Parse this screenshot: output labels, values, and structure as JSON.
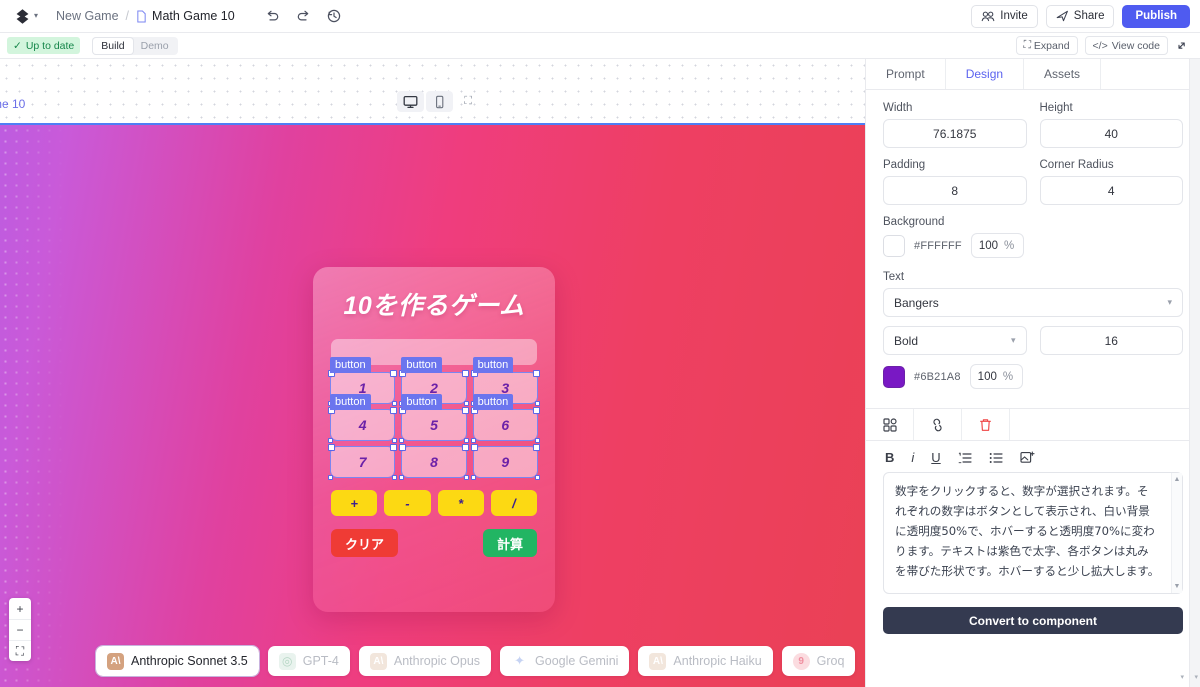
{
  "topbar": {
    "logo_icon": "editor-logo-icon",
    "logo_caret": "chevron-down-icon",
    "breadcrumb_project": "New Game",
    "breadcrumb_sep": "/",
    "breadcrumb_file": "Math Game 10",
    "file_icon": "file-icon",
    "undo_icon": "undo-icon",
    "redo_icon": "redo-icon",
    "history_icon": "history-icon",
    "invite_label": "Invite",
    "invite_icon": "people-icon",
    "share_label": "Share",
    "share_icon": "share-icon",
    "publish_label": "Publish"
  },
  "subbar": {
    "status_check": "✓",
    "status_label": "Up to date",
    "segments": [
      {
        "label": "Build",
        "active": true
      },
      {
        "label": "Demo",
        "active": false
      }
    ],
    "expand_label": "Expand",
    "expand_icon": "expand-corners-icon",
    "viewcode_label": "View code",
    "viewcode_icon": "code-brackets-icon",
    "diagonal_icon": "diagonal-arrows-icon"
  },
  "canvas": {
    "frame_label": "me 10",
    "device_desktop_icon": "monitor-icon",
    "device_mobile_icon": "phone-icon",
    "fullscreen_icon": "fullscreen-icon",
    "zoom_in": "+",
    "zoom_out": "−",
    "zoom_fit_icon": "fit-screen-icon",
    "bg_gradient_from": "#BD5CE0",
    "bg_gradient_to": "#EA4155"
  },
  "game": {
    "title": "10を作るゲーム",
    "display_value": "",
    "numbers": [
      "1",
      "2",
      "3",
      "4",
      "5",
      "6",
      "7",
      "8",
      "9"
    ],
    "selection_tag": "button",
    "operators": [
      "+",
      "-",
      "*",
      "/"
    ],
    "clear_label": "クリア",
    "calc_label": "計算",
    "clear_color": "#EF3B35",
    "calc_color": "#22B563",
    "operator_color": "#FCD913",
    "number_text_color": "#6B21A8"
  },
  "models": [
    {
      "label": "Anthropic Sonnet 3.5",
      "icon": "anthropic-icon",
      "glyph": "A\\",
      "bg": "#d4a27f",
      "fg": "#ffffff",
      "active": true
    },
    {
      "label": "GPT-4",
      "icon": "openai-icon",
      "glyph": "◎",
      "bg": "#e9f3ee",
      "fg": "#b5d6c4",
      "active": false
    },
    {
      "label": "Anthropic Opus",
      "icon": "anthropic-icon",
      "glyph": "A\\",
      "bg": "#f2e6dc",
      "fg": "#ffffff",
      "active": false
    },
    {
      "label": "Google Gemini",
      "icon": "gemini-sparkle-icon",
      "glyph": "✦",
      "bg": "#ffffff",
      "fg": "#c6d3f3",
      "active": false
    },
    {
      "label": "Anthropic Haiku",
      "icon": "anthropic-icon",
      "glyph": "A\\",
      "bg": "#f2e6dc",
      "fg": "#ffffff",
      "active": false
    },
    {
      "label": "Groq",
      "icon": "groq-icon",
      "glyph": "9",
      "bg": "#fbdce0",
      "fg": "#f08fa0",
      "active": false
    }
  ],
  "panel": {
    "tabs": [
      {
        "label": "Prompt",
        "active": false
      },
      {
        "label": "Design",
        "active": true
      },
      {
        "label": "Assets",
        "active": false
      }
    ],
    "width_label": "Width",
    "width_value": "76.1875",
    "height_label": "Height",
    "height_value": "40",
    "padding_label": "Padding",
    "padding_value": "8",
    "corner_label": "Corner Radius",
    "corner_value": "4",
    "background_label": "Background",
    "background_hex": "#FFFFFF",
    "background_opacity": "100",
    "background_unit": "%",
    "text_label": "Text",
    "font_family": "Bangers",
    "font_weight": "Bold",
    "font_size": "16",
    "text_hex": "#6B21A8",
    "text_opacity": "100",
    "text_unit": "%",
    "tools": {
      "components_icon": "components-grid-icon",
      "link_icon": "link-icon",
      "delete_icon": "trash-icon"
    },
    "format": {
      "bold": "B",
      "italic": "i",
      "underline": "U",
      "ordered_list_icon": "ordered-list-icon",
      "bullet_list_icon": "bullet-list-icon",
      "image_icon": "add-image-icon"
    },
    "description": "数字をクリックすると、数字が選択されます。それぞれの数字はボタンとして表示され、白い背景に透明度50%で、ホバーすると透明度70%に変わります。テキストは紫色で太字、各ボタンは丸みを帯びた形状です。ホバーすると少し拡大します。",
    "convert_label": "Convert to component"
  }
}
